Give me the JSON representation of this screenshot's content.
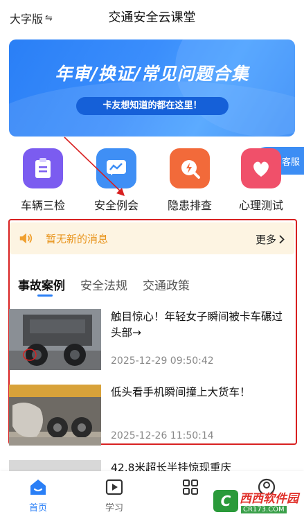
{
  "header": {
    "font_toggle": "大字版",
    "font_toggle_icon": "swap-arrows-icon",
    "title": "交通安全云课堂"
  },
  "banner": {
    "title": "年审/换证/常见问题合集",
    "subtitle": "卡友想知道的都在这里！",
    "slide_count": 5,
    "active_slide": 5
  },
  "service": {
    "label": "客服"
  },
  "quick_actions": [
    {
      "label": "车辆三检",
      "icon": "clipboard-icon",
      "color": "#7b5cf0"
    },
    {
      "label": "安全例会",
      "icon": "chart-message-icon",
      "color": "#3f8ff5"
    },
    {
      "label": "隐患排查",
      "icon": "lightning-search-icon",
      "color": "#f26a3a"
    },
    {
      "label": "心理测试",
      "icon": "heart-icon",
      "color": "#f0506a"
    }
  ],
  "notice": {
    "message": "暂无新的消息",
    "more": "更多"
  },
  "tabs": [
    {
      "label": "事故案例",
      "active": true
    },
    {
      "label": "安全法规",
      "active": false
    },
    {
      "label": "交通政策",
      "active": false
    }
  ],
  "news": [
    {
      "title": "触目惊心！年轻女子瞬间被卡车碾过头部→",
      "time": "2025-12-29 09:50:42"
    },
    {
      "title": "低头看手机瞬间撞上大货车！",
      "time": "2025-12-26 11:50:14"
    },
    {
      "title": "42.8米超长半挂惊现重庆",
      "time": ""
    }
  ],
  "bottom_nav": [
    {
      "label": "首页",
      "icon": "home-icon",
      "active": true
    },
    {
      "label": "学习",
      "icon": "play-icon",
      "active": false
    },
    {
      "label": "",
      "icon": "grid-icon",
      "active": false
    },
    {
      "label": "",
      "icon": "user-icon",
      "active": false
    }
  ],
  "watermark": {
    "text": "西西软件园",
    "sub": "CR173.COM"
  },
  "colors": {
    "accent": "#2a7ff6",
    "highlight_border": "#d82020",
    "notice_text": "#e8941c"
  }
}
